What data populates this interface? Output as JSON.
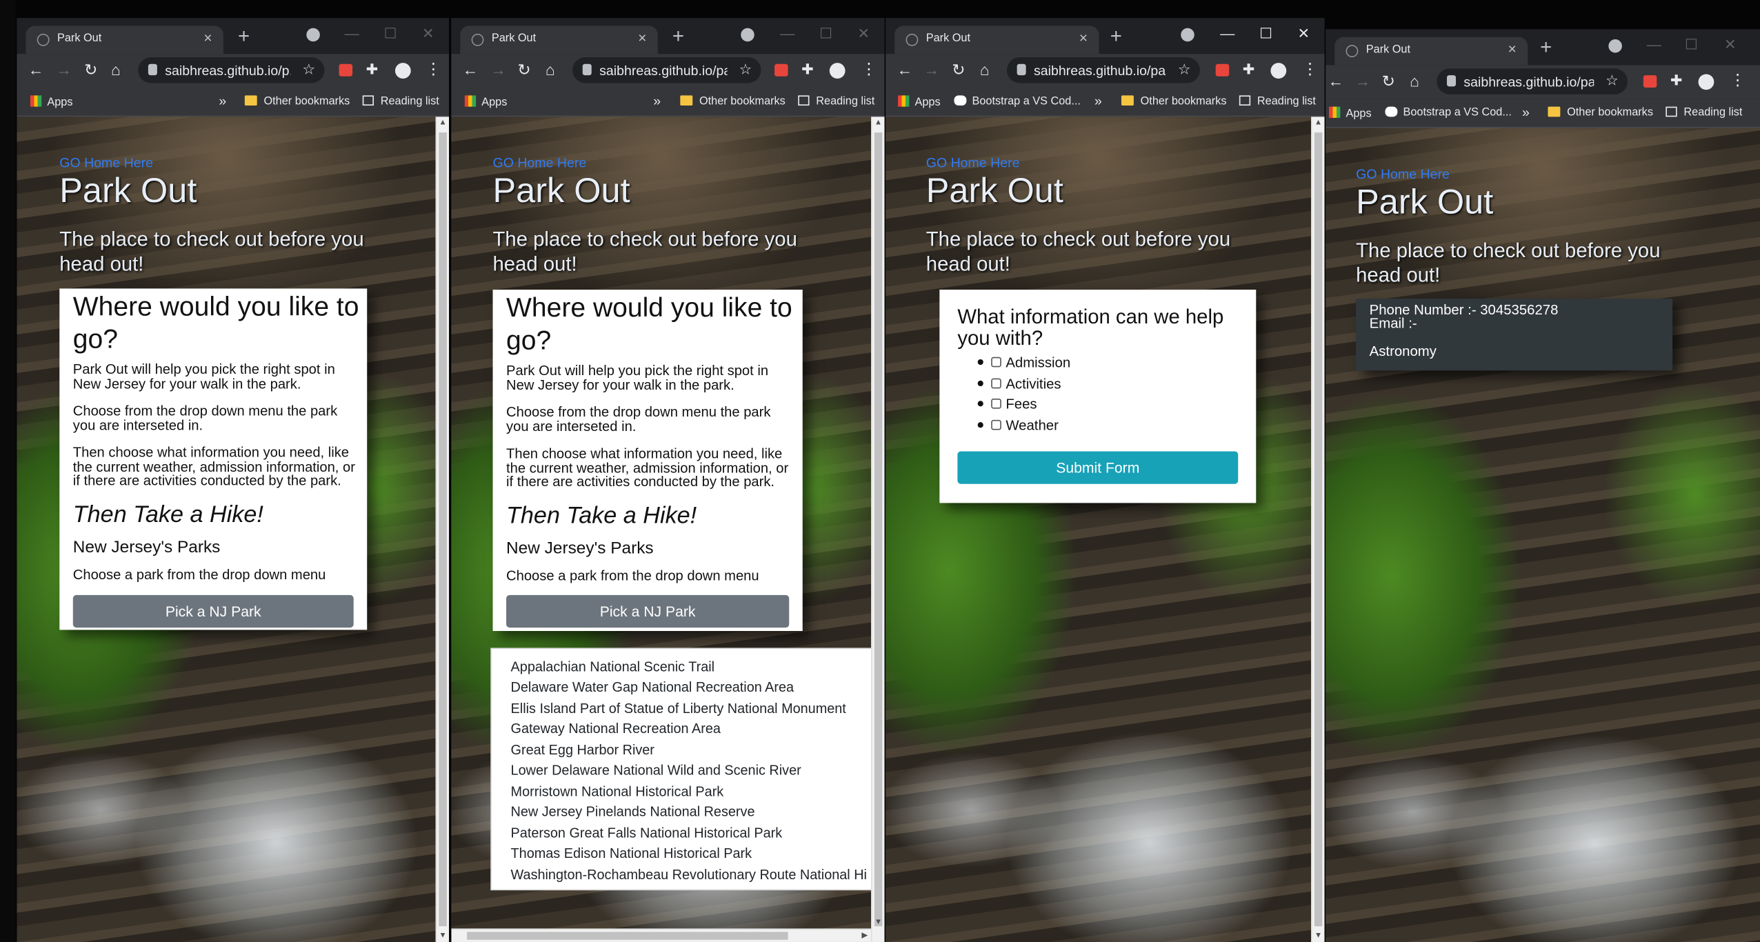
{
  "windows": [
    {
      "tab_title": "Park Out",
      "url": "saibhreas.github.io/p...",
      "bookmarks": {
        "apps": "Apps",
        "other": "Other bookmarks",
        "reading": "Reading list"
      },
      "page": {
        "home_link": "GO Home Here",
        "title": "Park Out",
        "tagline": "The place to check out before you head out!",
        "card_heading": "Where would you like to go?",
        "para1": "Park Out will help you pick the right spot in New Jersey for your walk in the park.",
        "para2": "Choose from the drop down menu the park you are interseted in.",
        "para3": "Then choose what information you need, like the current weather, admission information, or if there are activities conducted by the park.",
        "hike": "Then Take a Hike!",
        "parks_heading": "New Jersey's Parks",
        "choose_text": "Choose a park from the drop down menu",
        "button": "Pick a NJ Park"
      }
    },
    {
      "tab_title": "Park Out",
      "url": "saibhreas.github.io/pa...",
      "bookmarks": {
        "apps": "Apps",
        "other": "Other bookmarks",
        "reading": "Reading list"
      },
      "page": {
        "home_link": "GO Home Here",
        "title": "Park Out",
        "tagline": "The place to check out before you head out!",
        "card_heading": "Where would you like to go?",
        "para1": "Park Out will help you pick the right spot in New Jersey for your walk in the park.",
        "para2": "Choose from the drop down menu the park you are interseted in.",
        "para3": "Then choose what information you need, like the current weather, admission information, or if there are activities conducted by the park.",
        "hike": "Then Take a Hike!",
        "parks_heading": "New Jersey's Parks",
        "choose_text": "Choose a park from the drop down menu",
        "button": "Pick a NJ Park",
        "dropdown_items": [
          "Appalachian National Scenic Trail",
          "Delaware Water Gap National Recreation Area",
          "Ellis Island Part of Statue of Liberty National Monument",
          "Gateway National Recreation Area",
          "Great Egg Harbor River",
          "Lower Delaware National Wild and Scenic River",
          "Morristown National Historical Park",
          "New Jersey Pinelands National Reserve",
          "Paterson Great Falls National Historical Park",
          "Thomas Edison National Historical Park",
          "Washington-Rochambeau Revolutionary Route National Hi"
        ]
      }
    },
    {
      "tab_title": "Park Out",
      "url": "saibhreas.github.io/par...",
      "bookmarks": {
        "apps": "Apps",
        "bootstrap": "Bootstrap a VS Cod...",
        "other": "Other bookmarks",
        "reading": "Reading list"
      },
      "page": {
        "home_link": "GO Home Here",
        "title": "Park Out",
        "tagline": "The place to check out before you head out!",
        "form_heading": "What information can we help you with?",
        "options": [
          "Admission",
          "Activities",
          "Fees",
          "Weather"
        ],
        "submit": "Submit Form"
      }
    },
    {
      "tab_title": "Park Out",
      "url": "saibhreas.github.io/par...",
      "bookmarks": {
        "apps": "Apps",
        "bootstrap": "Bootstrap a VS Cod...",
        "other": "Other bookmarks",
        "reading": "Reading list"
      },
      "page": {
        "home_link": "GO Home Here",
        "title": "Park Out",
        "tagline": "The place to check out before you head out!",
        "phone": "Phone Number :- 3045356278",
        "email": "Email :-",
        "activity": "Astronomy"
      }
    }
  ],
  "colors": {
    "accent_teal": "#17a2b8",
    "button_gray": "#6c757d",
    "link_blue": "#2f7bf5",
    "chrome_dark": "#202124"
  }
}
